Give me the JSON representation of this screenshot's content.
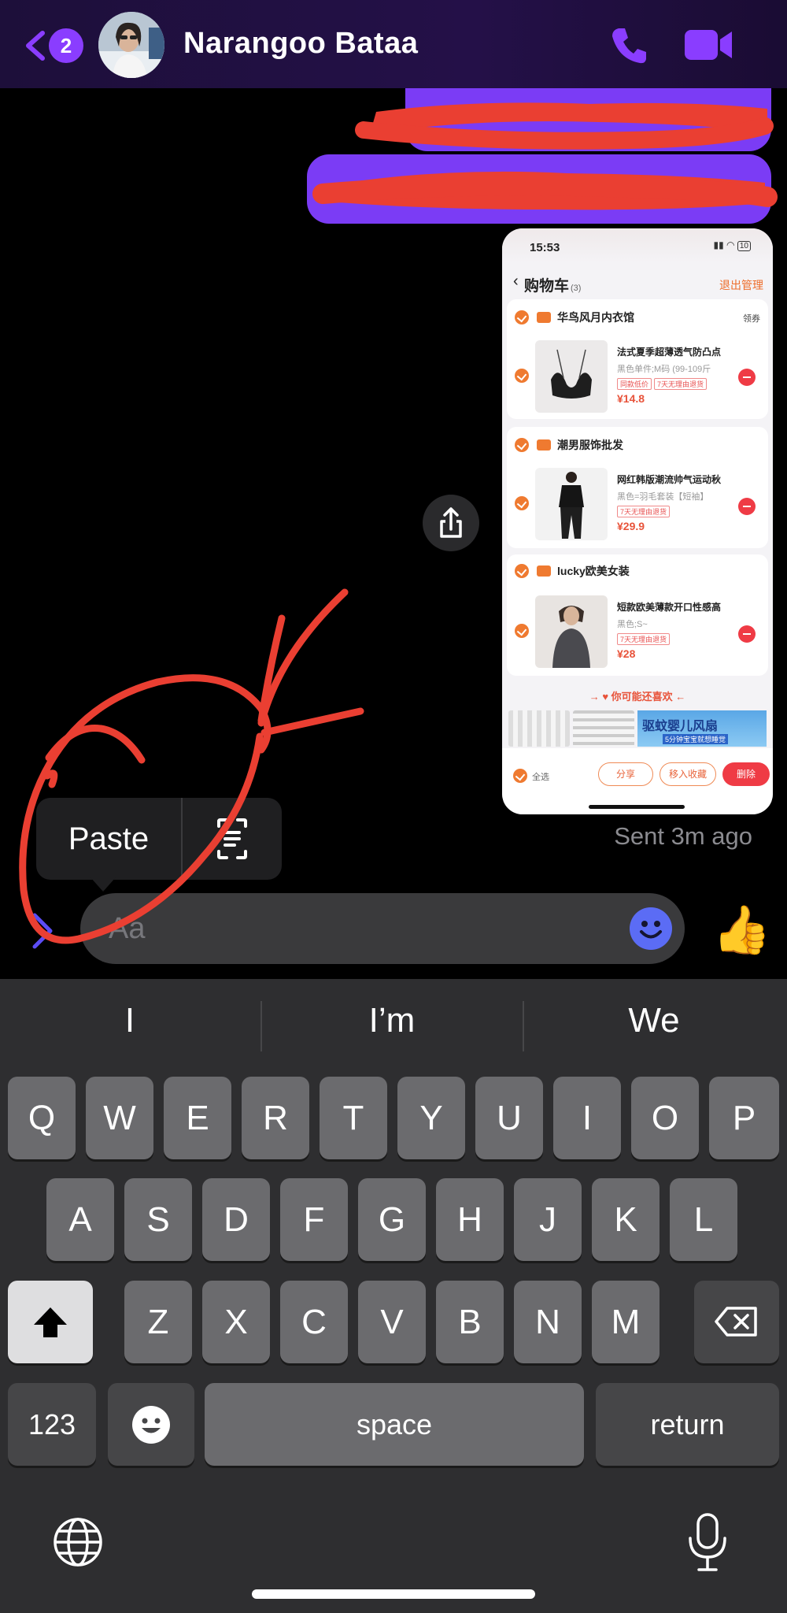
{
  "header": {
    "unread_badge": "2",
    "contact_name": "Narangoo Bataa"
  },
  "messages": {
    "sent_status": "Sent 3m ago"
  },
  "shared_screenshot": {
    "time": "15:53",
    "battery": "10",
    "title": "购物车",
    "count": "(3)",
    "manage": "退出管理",
    "coupon": "领券",
    "shops": [
      {
        "name": "华鸟风月内衣馆",
        "product_title": "法式夏季超薄透气防凸点",
        "spec": "黑色单件;M码 (99-109斤",
        "tags": [
          "同款低价",
          "7天无理由退货"
        ],
        "price": "¥14.8"
      },
      {
        "name": "潮男服饰批发",
        "product_title": "网红韩版潮流帅气运动秋",
        "spec": "黑色=羽毛套装【短袖】",
        "tags": [
          "7天无理由退货"
        ],
        "price": "¥29.9"
      },
      {
        "name": "lucky欧美女装",
        "product_title": "短款欧美薄款开口性感高",
        "spec": "黑色;S~",
        "tags": [
          "7天无理由退货"
        ],
        "price": "¥28"
      }
    ],
    "recommend_title": "→ ♥ 你可能还喜欢 ←",
    "ad_text": "驱蚊婴儿风扇",
    "ad_sub": "5分钟宝宝就想睡觉",
    "select_all": "全选",
    "share": "分享",
    "move_favorites": "移入收藏",
    "delete": "删除"
  },
  "context_menu": {
    "paste": "Paste"
  },
  "composer": {
    "placeholder": "Aa",
    "like_emoji": "👍"
  },
  "keyboard": {
    "suggestions": [
      "I",
      "I’m",
      "We"
    ],
    "row1": [
      "Q",
      "W",
      "E",
      "R",
      "T",
      "Y",
      "U",
      "I",
      "O",
      "P"
    ],
    "row2": [
      "A",
      "S",
      "D",
      "F",
      "G",
      "H",
      "J",
      "K",
      "L"
    ],
    "row3": [
      "Z",
      "X",
      "C",
      "V",
      "B",
      "N",
      "M"
    ],
    "numbers_key": "123",
    "space_key": "space",
    "return_key": "return"
  },
  "colors": {
    "accent": "#7b3cf5",
    "annotation_red": "#ea3f32",
    "background": "#000000"
  }
}
